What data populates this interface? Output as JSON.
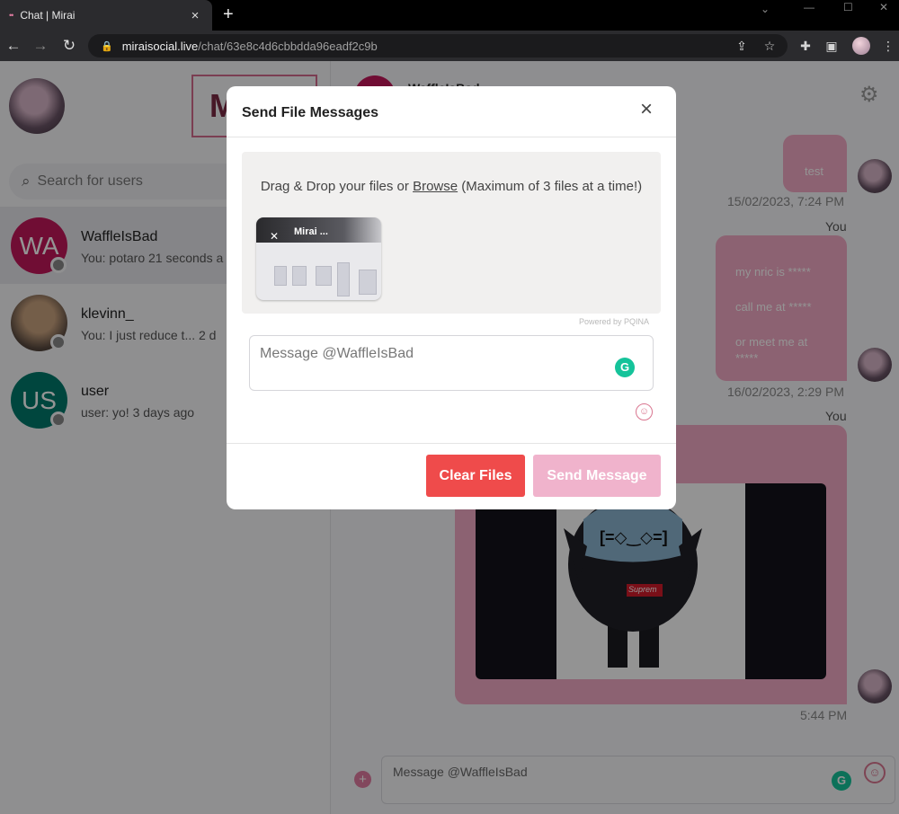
{
  "browser": {
    "tab_title": "Chat | Mirai",
    "tab_favicon": "••",
    "url_host": "miraisocial.live",
    "url_path": "/chat/63e8c4d6cbbdda96eadf2c9b"
  },
  "sidebar": {
    "logo_letter": "M",
    "search_placeholder": "Search for users",
    "conversations": [
      {
        "initials": "WA",
        "name": "WaffleIsBad",
        "preview": "You: potaro  21 seconds a",
        "avatar_color": "#c2185b",
        "active": true
      },
      {
        "initials": "",
        "name": "klevinn_",
        "preview": "You: I just reduce t...  2 d",
        "avatar_color": "#6b5a4e",
        "active": false
      },
      {
        "initials": "US",
        "name": "user",
        "preview": "user: yo!  3 days ago",
        "avatar_color": "#00796b",
        "active": false
      }
    ]
  },
  "chat": {
    "header_name": "WaffleIsBad",
    "messages": [
      {
        "text": "test",
        "time": "15/02/2023, 7:24 PM"
      },
      {
        "author": "You",
        "lines": [
          "my nric is *****",
          "call me at *****",
          "or meet me at",
          "*****"
        ],
        "time": "16/02/2023, 2:29 PM"
      },
      {
        "author": "You",
        "time": "5:44 PM",
        "image_text": "[=◇‿◇=]",
        "image_brand": "Suprem"
      }
    ],
    "composer_placeholder": "Message @WaffleIsBad"
  },
  "modal": {
    "title": "Send File Messages",
    "drop_text_before": "Drag & Drop your files or ",
    "drop_browse": "Browse",
    "drop_text_after": " (Maximum of 3 files at a time!)",
    "file_name": "Mirai ...",
    "powered_by": "Powered by PQINA",
    "message_placeholder": "Message @WaffleIsBad",
    "clear_button": "Clear Files",
    "send_button": "Send Message"
  },
  "colors": {
    "accent_pink": "#f2a9c4",
    "clear_red": "#ef4b4b",
    "send_pink": "#f0b3cc",
    "grammarly_green": "#15c39a"
  },
  "icons": [
    "search-icon",
    "close-icon",
    "gear-icon",
    "emoji-icon",
    "plus-icon",
    "grammarly-icon",
    "star-icon",
    "puzzle-icon",
    "share-icon"
  ]
}
